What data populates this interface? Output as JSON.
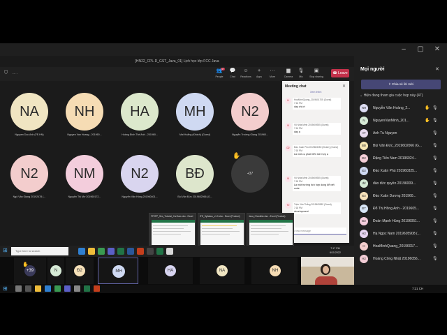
{
  "outer_window": {
    "controls": [
      "–",
      "▢",
      "✕"
    ]
  },
  "meeting_window": {
    "title": "[HN22_CPL.D_GST_Java_01] Lịch học lớp FCC Java",
    "search_text": "... .",
    "toolbar": {
      "people": "People",
      "people_count": "47",
      "chat": "Chat",
      "reactions": "Reactions",
      "apps": "Apps",
      "more": "More",
      "camera": "Camera",
      "mic": "Mic",
      "share": "Stop sharing",
      "leave": "Leave"
    }
  },
  "grid": {
    "tiles": [
      {
        "initials": "NA",
        "name": "Nguyen Duc Anh (FE.HN)",
        "color": "#f0e5c2"
      },
      {
        "initials": "NH",
        "name": "Nguyen Van Hoang - 201960...",
        "color": "#f6dcb4"
      },
      {
        "initials": "HA",
        "name": "Hoàng Đình Thế Anh - 201960...",
        "color": "#dce8cc"
      },
      {
        "initials": "MH",
        "name": "Mai Hoằng (Khách) (Guest)",
        "color": "#cfd9f2"
      },
      {
        "initials": "N2",
        "name": "Nguyễn Trường Giang 201960...",
        "color": "#f3cdcd"
      },
      {
        "initials": "N2",
        "name": "Ngô Văn Giang 20192478 (...",
        "color": "#f3cdcd"
      },
      {
        "initials": "NM",
        "name": "Nguyễn Thị Mơ 201960172...",
        "color": "#f3cddc"
      },
      {
        "initials": "N2",
        "name": "Nguyễn Văn Hồng 201960401...",
        "color": "#d9d5ef"
      },
      {
        "initials": "BĐ",
        "name": "Bùi Văn Đức 2019602066 (G...",
        "color": "#dde6cc"
      }
    ],
    "more_count": "+37"
  },
  "chat": {
    "title": "Meeting chat",
    "tab": "Xem thêm",
    "messages": [
      {
        "initials": "H",
        "author": "HoaMinhQuang_2019601705 (Guest)",
        "time": "7:16 PM",
        "text": "dạy chị ơi"
      },
      {
        "initials": "VI",
        "author": "Vũ Nhật Minh 2019605935 (Guest)",
        "time": "7:16 PM",
        "text": "dạy ạ"
      },
      {
        "initials": "D2",
        "author": "Đào Xuân Phú 2019603250 (Khách) (Guest)",
        "time": "7:18 PM",
        "text": "Là một cụ phát triển tích hợp ạ"
      },
      {
        "initials": "VI",
        "author": "Vũ Nhật Minh 2019605935 (Guest)",
        "time": "7:18 PM",
        "text": "Là một trường tích hợp dùng để viết code"
      },
      {
        "initials": "T2",
        "author": "Trịnh Văn Thắng 2019609552 (Guest)",
        "time": "7:18 PM",
        "text": "development"
      }
    ],
    "input_placeholder": "Type a new message"
  },
  "thumbnails": [
    {
      "title": "FFEPP_Ses_Tutorial_CurSum.xlsx - Excel"
    },
    {
      "title": "IFE_Syllabus_v1.0.xlsx - Excel (Product)"
    },
    {
      "title": "Java_Checklist.xlsx - Excel (Product)"
    }
  ],
  "inner_taskbar": {
    "search_placeholder": "Type here to search",
    "time": "7:17 PM",
    "date": "6/11/2022"
  },
  "strip": {
    "more": "+39",
    "avatars": [
      {
        "initials": "N",
        "color": "#d6ead6"
      },
      {
        "initials": "Đ2",
        "color": "#f6e1b9"
      },
      {
        "initials": "MH",
        "color": "#cfd9f2"
      },
      {
        "initials": "HA",
        "color": "#d7d4f0"
      },
      {
        "initials": "NA",
        "color": "#f0e5c2"
      },
      {
        "initials": "NH",
        "color": "#f6dcb4"
      }
    ]
  },
  "people": {
    "title": "Mọi người",
    "invite": "Chia sẻ lời mời",
    "section": "Hiện đang tham gia cuộc họp này (47)",
    "list": [
      {
        "initials": "NH",
        "name": "Nguyễn Văn Hoàng_2...",
        "color": "#dcdcf2",
        "hand": true
      },
      {
        "initials": "N",
        "name": "NguyenVanMinh_201...",
        "color": "#d6ead6",
        "hand": true
      },
      {
        "initials": "AT",
        "name": "Anh Tu Nguyen",
        "color": "#e8dbef",
        "hand": false
      },
      {
        "initials": "BĐ",
        "name": "Bùi Văn Đức_2019602066 (G...",
        "color": "#f6e6b4",
        "hand": false
      },
      {
        "initials": "Đ2",
        "name": "Đặng Tiến Nam 20196024...",
        "color": "#f3cdd6",
        "hand": false
      },
      {
        "initials": "Đ2",
        "name": "Đào Xuân Phú 201960325...",
        "color": "#cfd9f2",
        "hand": false
      },
      {
        "initials": "đđ",
        "name": "đào đức quyền 20196009...",
        "color": "#d6ead6",
        "hand": false
      },
      {
        "initials": "Đ2",
        "name": "Đào Xuân Dương 201960...",
        "color": "#f6e1b9",
        "hand": false
      },
      {
        "initials": "ĐT",
        "name": "Đỗ Thị Hồng Anh - 2019605...",
        "color": "#d6e4f5",
        "hand": false
      },
      {
        "initials": "Đ2",
        "name": "Đoàn Mạnh Hùng 20196051...",
        "color": "#f3cddc",
        "hand": false
      },
      {
        "initials": "H2",
        "name": "Hạ Ngọc Nam 2019605908 (...",
        "color": "#e6d4f0",
        "hand": false
      },
      {
        "initials": "H",
        "name": "HoaMinhQuang_20196017...",
        "color": "#f3cdcd",
        "hand": false
      },
      {
        "initials": "H2",
        "name": "Hoàng Công Nhật 20196056...",
        "color": "#f3cdd6",
        "hand": false
      }
    ]
  },
  "win_taskbar": {
    "time": "7:21 CH"
  }
}
